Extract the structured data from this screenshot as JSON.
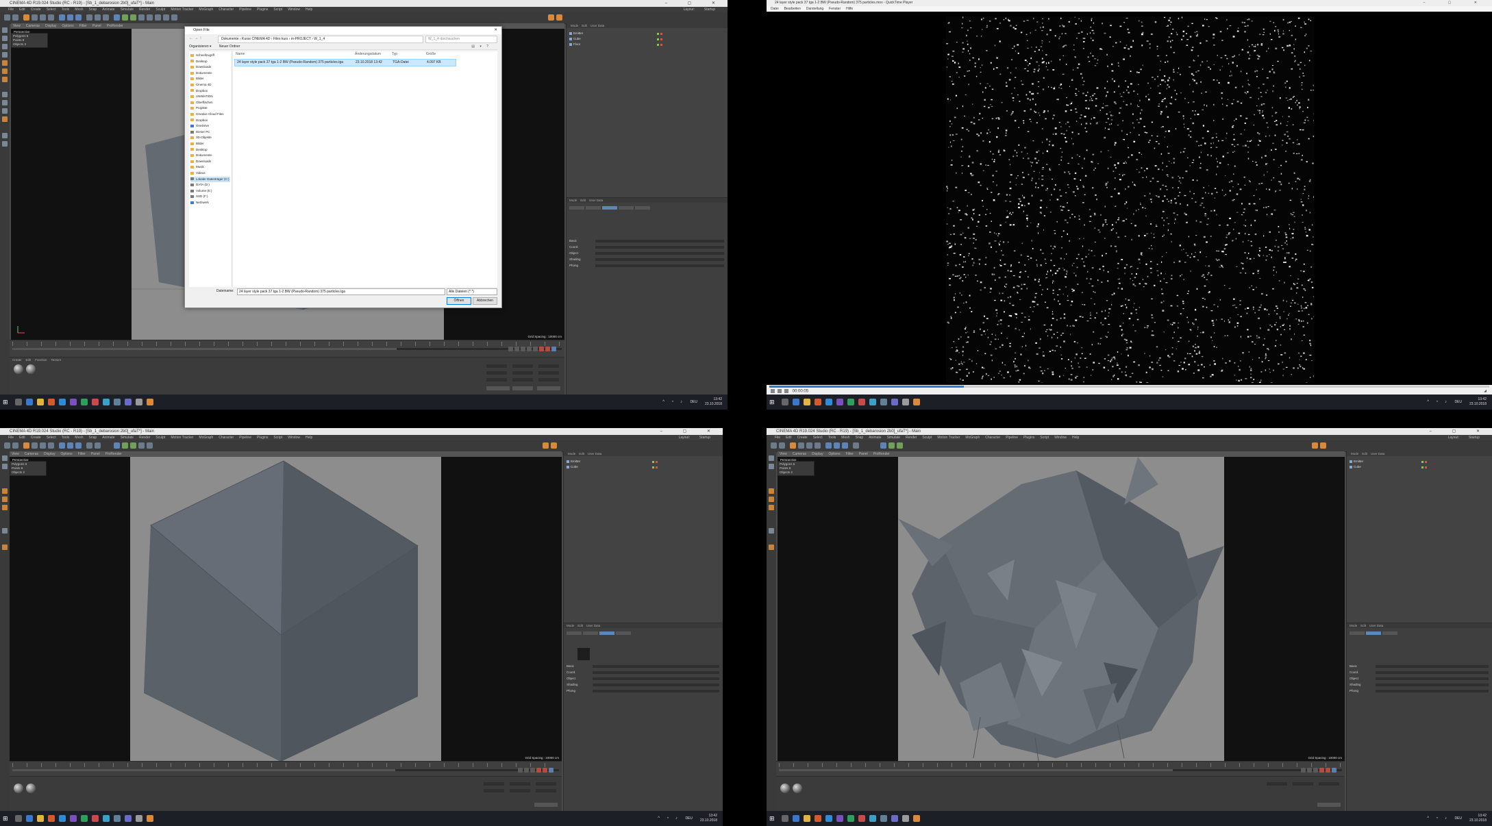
{
  "colors": {
    "c4d_bg": "#4a4a4a",
    "viewport_bg": "#8d8d8d",
    "accent_orange": "#d8893a",
    "accent_blue": "#5d83b8",
    "selection": "#cce8ff",
    "taskbar": "#1c1f26"
  },
  "top_left": {
    "title": "CINEMA 4D R19.024 Studio (RC - R19) - [Sb_1_debarosion 2b0]_ufaT*] - Main",
    "menu": [
      "File",
      "Edit",
      "Create",
      "Select",
      "Tools",
      "Mesh",
      "Snap",
      "Animate",
      "Simulate",
      "Render",
      "Sculpt",
      "Motion Tracker",
      "MoGraph",
      "Character",
      "Pipeline",
      "Plugins",
      "Script",
      "Window",
      "Help"
    ],
    "layout_label": "Layout:",
    "layout_value": "Startup",
    "viewport_menu": [
      "View",
      "Cameras",
      "Display",
      "Options",
      "Filter",
      "Panel",
      "ProRender"
    ],
    "viewport_label": "Perspective",
    "grid_spacing": "Grid Spacing : 10000 cm",
    "dialog": {
      "title": "Open File",
      "path": [
        "Dokumente",
        "Kurse CINEMA 4D",
        "Files kurs",
        "m-PROJECT",
        "W_1_4"
      ],
      "search_placeholder": "W_1_4 durchsuchen",
      "cmd_organize": "Organisieren ▾",
      "cmd_new_folder": "Neuer Ordner",
      "nav_items": [
        {
          "label": "Schnellzugriff",
          "icon": "star-icon"
        },
        {
          "label": "Desktop",
          "icon": "folder-icon"
        },
        {
          "label": "Downloads",
          "icon": "download-icon"
        },
        {
          "label": "Dokumente",
          "icon": "folder-icon"
        },
        {
          "label": "Bilder",
          "icon": "folder-icon"
        },
        {
          "label": "Cinema 4D",
          "icon": "folder-icon"
        },
        {
          "label": "Dropbox",
          "icon": "folder-icon"
        },
        {
          "label": "ANIMATION",
          "icon": "folder-icon"
        },
        {
          "label": "Oberflächen",
          "icon": "folder-icon"
        },
        {
          "label": "Projekte",
          "icon": "folder-icon"
        },
        {
          "label": "Creative Cloud Files",
          "icon": "folder-icon"
        },
        {
          "label": "Dropbox",
          "icon": "folder-icon"
        },
        {
          "label": "OneDrive",
          "icon": "cloud-icon"
        },
        {
          "label": "Dieser PC",
          "icon": "pc-icon"
        },
        {
          "label": "3D-Objekte",
          "icon": "folder-icon"
        },
        {
          "label": "Bilder",
          "icon": "folder-icon"
        },
        {
          "label": "Desktop",
          "icon": "folder-icon"
        },
        {
          "label": "Dokumente",
          "icon": "folder-icon"
        },
        {
          "label": "Downloads",
          "icon": "folder-icon"
        },
        {
          "label": "Musik",
          "icon": "folder-icon"
        },
        {
          "label": "Videos",
          "icon": "folder-icon"
        },
        {
          "label": "Lokaler Datenträger (C:)",
          "icon": "drive-icon"
        },
        {
          "label": "DATA (D:)",
          "icon": "drive-icon"
        },
        {
          "label": "Volume (E:)",
          "icon": "drive-icon"
        },
        {
          "label": "SSD (F:)",
          "icon": "drive-icon"
        },
        {
          "label": "Netzwerk",
          "icon": "network-icon"
        }
      ],
      "columns": [
        "Name",
        "Änderungsdatum",
        "Typ",
        "Größe"
      ],
      "file": {
        "name": "24 layer style pack 37 tga 1-2 BW (Pseudo-Random) 375 particles.tga",
        "date": "23.10.2018 13:42",
        "type": "TGA-Datei",
        "size": "4.097 KB"
      },
      "filename_label": "Dateiname:",
      "filename_value": "24 layer style pack 37 tga 1-2 BW (Pseudo-Random) 375 particles.tga",
      "filetype_value": "Alle Dateien (*.*)",
      "open_button": "Öffnen",
      "cancel_button": "Abbrechen"
    },
    "objects": [
      "Emitter",
      "Cube",
      "Floor"
    ],
    "attr_menu": [
      "Mode",
      "Edit",
      "User Data"
    ],
    "attr_rows": [
      "Basic",
      "Coord.",
      "Object",
      "Shading",
      "Phong"
    ],
    "material_menu": [
      "Create",
      "Edit",
      "Function",
      "Texture"
    ]
  },
  "top_right": {
    "title": "24 layer style pack 37 tga 1-2 BW (Pseudo-Random) 375 particles.mov - QuickTime Player",
    "menu": [
      "Datei",
      "Bearbeiten",
      "Darstellung",
      "Fenster",
      "Hilfe"
    ],
    "timecode": "00:00:05",
    "progress_pct": 27
  },
  "bottom_left": {
    "title": "CINEMA 4D R19.024 Studio (RC - R19) - [Sb_1_debarosion 2b0]_ufaT*] - Main",
    "viewport_label": "Perspective",
    "grid_spacing": "Grid Spacing : 10000 cm",
    "objects": [
      "Emitter",
      "Cube"
    ],
    "attr_rows": [
      "Basic",
      "Coord.",
      "Object",
      "Shading",
      "Phong"
    ]
  },
  "bottom_right": {
    "title": "CINEMA 4D R19.024 Studio (RC - R19) - [Sb_1_debarosion 2b0]_ufaT*] - Main",
    "viewport_label": "Perspective",
    "grid_spacing": "Grid Spacing : 10000 cm",
    "objects": [
      "Emitter",
      "Cube"
    ],
    "attr_rows": [
      "Basic",
      "Coord.",
      "Object",
      "Shading",
      "Phong"
    ]
  },
  "taskbar": {
    "time": "13:42",
    "date": "23.10.2018",
    "lang": "DEU"
  }
}
